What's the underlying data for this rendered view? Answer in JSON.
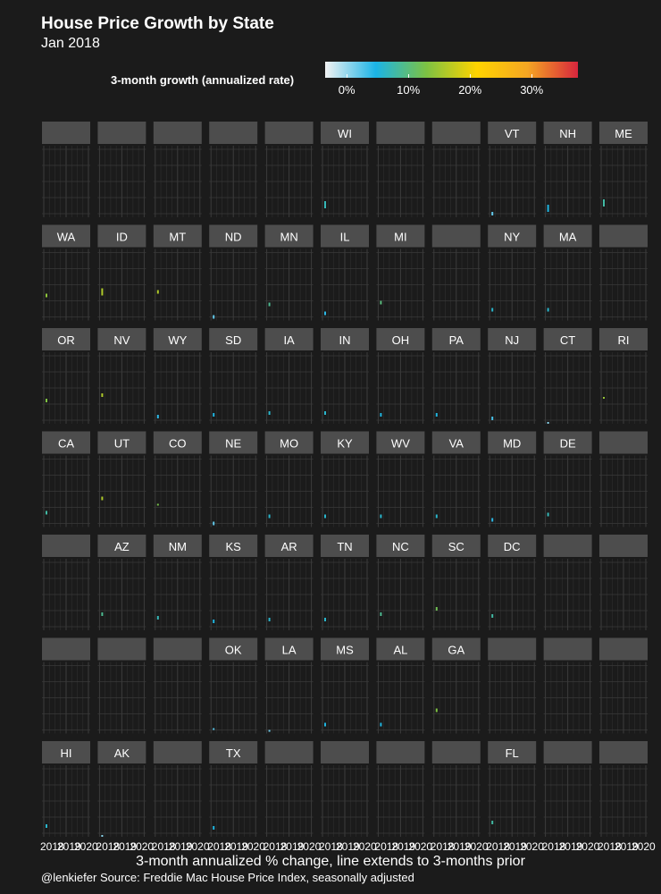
{
  "header": {
    "title": "House Price Growth by State",
    "subtitle": "Jan 2018"
  },
  "legend": {
    "title": "3-month growth (annualized rate)",
    "ticks": [
      "0%",
      "10%",
      "20%",
      "30%"
    ],
    "tick_values": [
      0,
      10,
      20,
      30
    ],
    "range": [
      -3.5,
      37.5
    ],
    "colors": [
      "#f2f2f2",
      "#1bb4e6",
      "#7cc243",
      "#ffd400",
      "#f5a623",
      "#d7263d"
    ]
  },
  "axis": {
    "xlabel": "3-month annualized % change, line extends to 3-months prior",
    "tick_labels": [
      "2018",
      "2019",
      "2020"
    ]
  },
  "caption": "@lenkiefer Source: Freddie Mac House Price Index, seasonally adjusted",
  "chart_data": {
    "type": "bar",
    "grid": true,
    "x_range": [
      2018,
      2020
    ],
    "y_range": [
      0,
      40
    ],
    "grid_rows": [
      [
        "",
        "",
        "",
        "",
        "",
        "WI",
        "",
        "",
        "VT",
        "NH",
        "ME"
      ],
      [
        "WA",
        "ID",
        "MT",
        "ND",
        "MN",
        "IL",
        "MI",
        "",
        "NY",
        "MA",
        ""
      ],
      [
        "OR",
        "NV",
        "WY",
        "SD",
        "IA",
        "IN",
        "OH",
        "PA",
        "NJ",
        "CT",
        "RI"
      ],
      [
        "CA",
        "UT",
        "CO",
        "NE",
        "MO",
        "KY",
        "WV",
        "VA",
        "MD",
        "DE",
        ""
      ],
      [
        "",
        "AZ",
        "NM",
        "KS",
        "AR",
        "TN",
        "NC",
        "SC",
        "DC",
        "",
        ""
      ],
      [
        "",
        "",
        "",
        "OK",
        "LA",
        "MS",
        "AL",
        "GA",
        "",
        "",
        ""
      ],
      [
        "HI",
        "AK",
        "",
        "TX",
        "",
        "",
        "",
        "",
        "FL",
        "",
        ""
      ]
    ],
    "growth": {
      "WI": [
        5,
        9
      ],
      "VT": [
        1,
        3
      ],
      "NH": [
        3,
        7
      ],
      "ME": [
        6,
        10
      ],
      "WA": [
        13,
        15
      ],
      "ID": [
        14,
        18
      ],
      "MT": [
        15,
        17
      ],
      "ND": [
        1,
        3
      ],
      "MN": [
        8,
        10
      ],
      "IL": [
        3,
        5
      ],
      "MI": [
        9,
        11
      ],
      "NY": [
        5,
        7
      ],
      "MA": [
        5,
        7
      ],
      "OR": [
        12,
        14
      ],
      "NV": [
        15,
        17
      ],
      "WY": [
        3,
        5
      ],
      "SD": [
        4,
        6
      ],
      "IA": [
        5,
        7
      ],
      "IN": [
        5,
        7
      ],
      "OH": [
        4,
        6
      ],
      "PA": [
        4,
        6
      ],
      "NJ": [
        2,
        4
      ],
      "CT": [
        0,
        1
      ],
      "RI": [
        14,
        15
      ],
      "CA": [
        7,
        9
      ],
      "UT": [
        15,
        17
      ],
      "CO": [
        12,
        13
      ],
      "NE": [
        1,
        3
      ],
      "MO": [
        5,
        7
      ],
      "KY": [
        5,
        7
      ],
      "WV": [
        5,
        7
      ],
      "VA": [
        5,
        7
      ],
      "MD": [
        3,
        5
      ],
      "DE": [
        6,
        8
      ],
      "AZ": [
        8,
        10
      ],
      "NM": [
        6,
        8
      ],
      "KS": [
        4,
        6
      ],
      "AR": [
        5,
        7
      ],
      "TN": [
        5,
        7
      ],
      "NC": [
        8,
        10
      ],
      "SC": [
        11,
        13
      ],
      "DC": [
        7,
        9
      ],
      "OK": [
        2,
        3
      ],
      "LA": [
        1,
        2
      ],
      "MS": [
        4,
        6
      ],
      "AL": [
        4,
        6
      ],
      "GA": [
        12,
        14
      ],
      "HI": [
        5,
        7
      ],
      "AK": [
        0,
        1
      ],
      "TX": [
        4,
        6
      ],
      "FL": [
        7,
        9
      ]
    }
  }
}
